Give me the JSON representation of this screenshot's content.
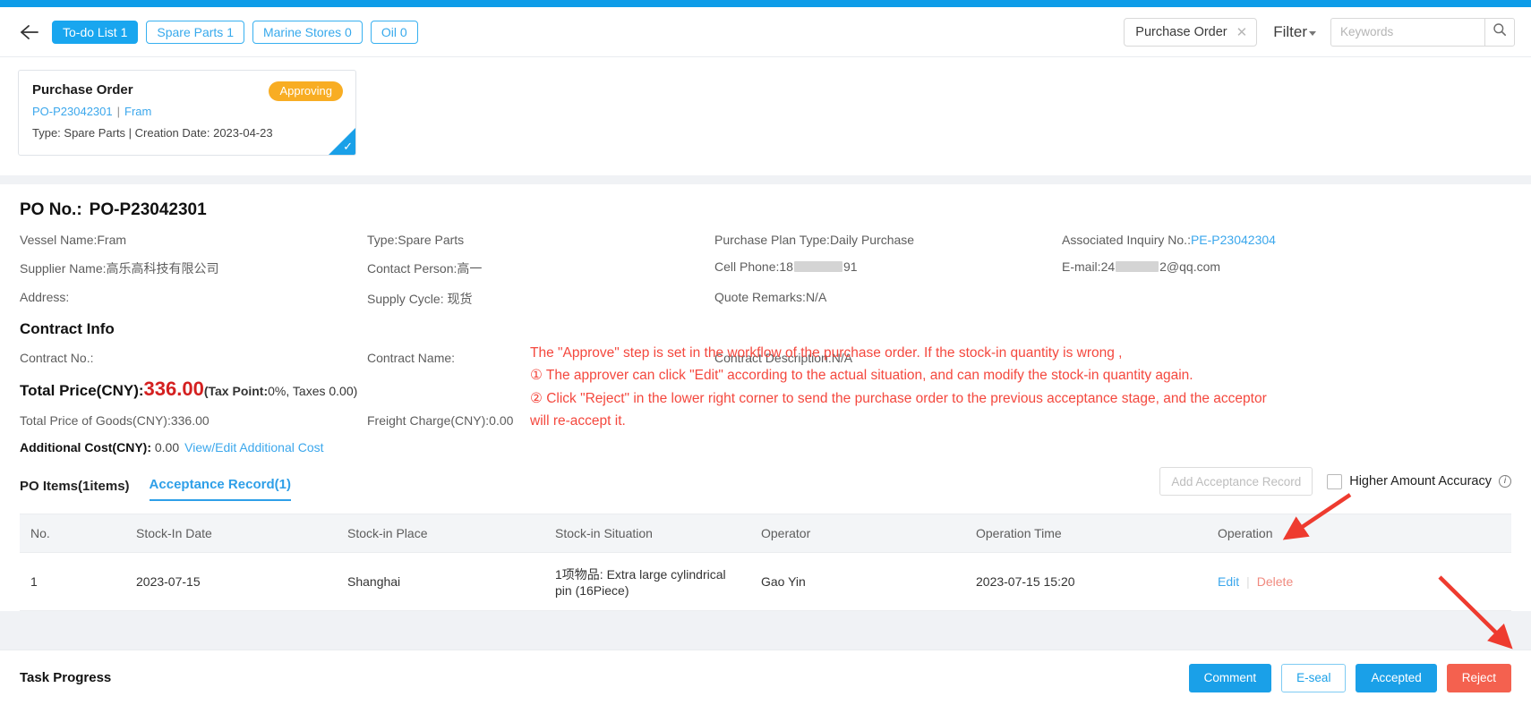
{
  "header": {
    "back_icon": "arrow-left-icon",
    "chips": [
      {
        "label": "To-do List 1",
        "active": true
      },
      {
        "label": "Spare Parts 1",
        "active": false
      },
      {
        "label": "Marine Stores 0",
        "active": false
      },
      {
        "label": "Oil 0",
        "active": false
      }
    ],
    "tag": {
      "label": "Purchase Order",
      "close_icon": "close-icon"
    },
    "filter_label": "Filter",
    "search": {
      "value": "",
      "placeholder": "Keywords",
      "icon": "search-icon"
    }
  },
  "card": {
    "title": "Purchase Order",
    "status": "Approving",
    "po_no": "PO-P23042301",
    "vessel": "Fram",
    "meta": "Type:  Spare Parts  |  Creation Date:  2023-04-23",
    "selected_icon": "check-icon"
  },
  "detail": {
    "po_no_label": "PO No.:",
    "po_no_value": "PO-P23042301",
    "fields": [
      {
        "label": "Vessel Name:",
        "value": "Fram"
      },
      {
        "label": "Type:",
        "value": "Spare Parts"
      },
      {
        "label": "Purchase Plan Type:",
        "value": "Daily Purchase"
      },
      {
        "label": "Associated Inquiry No.:",
        "value": "PE-P23042304",
        "link": true
      },
      {
        "label": "Supplier Name:",
        "value": "高乐高科技有限公司"
      },
      {
        "label": "Contact Person:",
        "value": "高一"
      },
      {
        "label": "Cell Phone:",
        "value": "18",
        "redacted": true,
        "value_tail": "91"
      },
      {
        "label": "E-mail:",
        "value": "24",
        "redacted": true,
        "value_tail": "2@qq.com"
      },
      {
        "label": "Address:",
        "value": ""
      },
      {
        "label": "Supply Cycle:",
        "value": " 现货"
      },
      {
        "label": "Quote Remarks:",
        "value": "N/A"
      },
      {
        "label": "",
        "value": ""
      }
    ],
    "contract_section_title": "Contract Info",
    "contract_fields": [
      {
        "label": "Contract No.:",
        "value": ""
      },
      {
        "label": "Contract Name:",
        "value": ""
      },
      {
        "label": "Contract Description:",
        "value": "N/A"
      },
      {
        "label": "",
        "value": ""
      }
    ],
    "total_price_label": "Total Price(CNY):",
    "total_price_value": "336.00",
    "total_price_tax_prefix": "(Tax Point:",
    "total_price_tax_value": "0%, Taxes 0.00)",
    "total_goods": "Total Price of Goods(CNY):336.00",
    "freight": "Freight Charge(CNY):0.00",
    "additional_cost_label": "Additional Cost(CNY):",
    "additional_cost_value": "0.00",
    "additional_cost_link": "View/Edit Additional Cost"
  },
  "annotation": {
    "line1": "The \"Approve\" step is set in the workflow of the purchase order. If the stock-in quantity is wrong ,",
    "line2": "① The approver can click \"Edit\" according to the actual situation, and can modify the stock-in quantity again.",
    "line3": "② Click \"Reject\" in the lower right corner to send the purchase order to the previous acceptance stage, and the acceptor",
    "line4": "will re-accept it.",
    "color": "#f4483e"
  },
  "tabs": [
    {
      "label": "PO Items(1items)",
      "active": false
    },
    {
      "label": "Acceptance Record(1)",
      "active": true
    }
  ],
  "tab_actions": {
    "add_record_label": "Add Acceptance Record",
    "higher_accuracy_label": "Higher Amount Accuracy",
    "info_icon": "info-icon",
    "checkbox_checked": false
  },
  "table": {
    "columns": [
      "No.",
      "Stock-In Date",
      "Stock-in Place",
      "Stock-in Situation",
      "Operator",
      "Operation Time",
      "Operation"
    ],
    "rows": [
      {
        "no": "1",
        "stock_in_date": "2023-07-15",
        "stock_in_place": "Shanghai",
        "stock_in_situation": "1项物品:  Extra large cylindrical pin (16Piece)",
        "operator": "Gao Yin",
        "operation_time": "2023-07-15 15:20",
        "action_edit": "Edit",
        "action_delete": "Delete"
      }
    ]
  },
  "footer": {
    "task_progress_label": "Task Progress",
    "buttons": [
      {
        "label": "Comment",
        "style": "primary"
      },
      {
        "label": "E-seal",
        "style": "ghost"
      },
      {
        "label": "Accepted",
        "style": "primary"
      },
      {
        "label": "Reject",
        "style": "danger"
      }
    ]
  },
  "colors": {
    "accent": "#1aa0e8",
    "status_badge": "#f8ad23",
    "price_red": "#d42020",
    "annotation_red": "#f4483e",
    "reject_red": "#f4614f"
  }
}
